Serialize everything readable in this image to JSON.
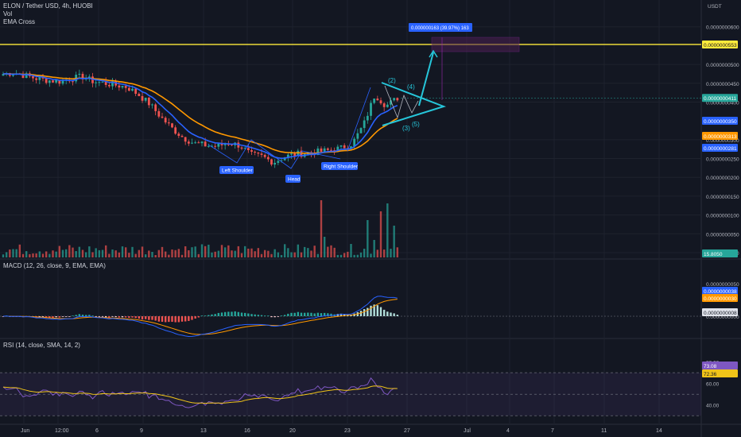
{
  "colors": {
    "background": "#131722",
    "grid": "#1e222d",
    "up": "#26a69a",
    "down": "#ef5350",
    "ema_fast": "#2962ff",
    "ema_slow": "#ff9800",
    "target_line": "#ffeb3b",
    "pattern": "#26c6da",
    "macd": "#2962ff",
    "signal": "#ff9800",
    "rsi": "#7e57c2",
    "rsi_ma": "#f0c419",
    "label_blue": "#2962ff",
    "projection_box": "#4a2050"
  },
  "header": {
    "symbol": "ELON / Tether USD, 4h, HUOBI",
    "volume": "Vol",
    "ema": "EMA Cross"
  },
  "price_axis": {
    "unit": "USDT",
    "ticks": [
      "0.0000000600",
      "0.0000000500",
      "0.0000000450",
      "0.0000000400",
      "0.0000000300",
      "0.0000000250",
      "0.0000000200",
      "0.0000000150",
      "0.0000000100",
      "0.0000000050",
      "0.0000000000"
    ],
    "tag_target": "0.0000000553",
    "tag_price": "0.0000000411",
    "tag_ema_fast": "0.0000000350",
    "tag_ema_slow": "0.0000000313",
    "tag_other": "0.0000000281",
    "tag_volume": "15.8050"
  },
  "macd_panel": {
    "title": "MACD (12, 26, close, 9, EMA, EMA)",
    "ticks": [
      "0.0000000050",
      "0.0000000000"
    ],
    "tag_macd": "0.0000000038",
    "tag_signal": "0.0000000030",
    "tag_hist": "0.0000000008"
  },
  "rsi_panel": {
    "title": "RSI (14, close, SMA, 14, 2)",
    "ticks": [
      "80.00",
      "60.00",
      "40.00"
    ],
    "tag_rsi": "73.08",
    "tag_ma": "72.36"
  },
  "time_axis": [
    "Jun",
    "12:00",
    "6",
    "9",
    "13",
    "16",
    "20",
    "23",
    "27",
    "Jul",
    "4",
    "7",
    "11",
    "14"
  ],
  "annotations": {
    "measure": "0.000000163 (39.97%) 163",
    "left_shoulder": "Left Shoulder",
    "head": "Head",
    "right_shoulder": "Right Shoulder",
    "wave2": "(2)",
    "wave3": "(3)",
    "wave4": "(4)",
    "wave5": "(5)"
  },
  "chart_data": {
    "type": "candlestick",
    "xlabel": "",
    "ylabel": "",
    "ylim": [
      0,
      6.5e-08
    ],
    "target": 5.53e-08,
    "last_price": 4.11e-08,
    "series_close": [
      4.75e-08,
      4.78e-08,
      4.7e-08,
      4.62e-08,
      4.58e-08,
      4.55e-08,
      4.62e-08,
      4.68e-08,
      4.55e-08,
      4.5e-08,
      4.45e-08,
      4.4e-08,
      4.2e-08,
      3.95e-08,
      3.6e-08,
      3.3e-08,
      3.05e-08,
      2.9e-08,
      2.85e-08,
      2.82e-08,
      2.92e-08,
      2.85e-08,
      2.6e-08,
      2.55e-08,
      2.4e-08,
      2.55e-08,
      2.62e-08,
      2.65e-08,
      2.68e-08,
      2.72e-08,
      2.78e-08,
      2.9e-08,
      3.4e-08,
      4.2e-08,
      3.9e-08,
      4.11e-08
    ]
  }
}
